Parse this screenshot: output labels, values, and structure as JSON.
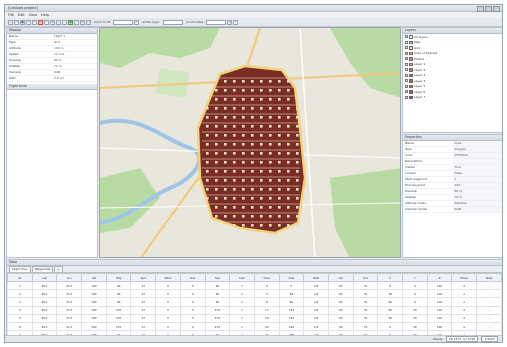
{
  "app": {
    "title": "[Untitled project]",
    "window_buttons": [
      "minimize",
      "maximize",
      "close"
    ]
  },
  "menu": [
    "File",
    "Edit",
    "View",
    "Help"
  ],
  "toolbar": {
    "zoom_label": "zoom to fit",
    "layer_label": "active layer",
    "coord_label": "coordinates"
  },
  "left_panel": {
    "title": "Mission",
    "properties": [
      {
        "key": "Name",
        "value": "Flight 1"
      },
      {
        "key": "Type",
        "value": "Grid"
      },
      {
        "key": "Altitude",
        "value": "100 m"
      },
      {
        "key": "Speed",
        "value": "12 m/s"
      },
      {
        "key": "Overlap",
        "value": "80 %"
      },
      {
        "key": "Sidelap",
        "value": "70 %"
      },
      {
        "key": "Camera",
        "value": "RGB"
      },
      {
        "key": "GSD",
        "value": "2.8 cm"
      }
    ],
    "footer": "Flight time"
  },
  "layers_panel": {
    "title": "Layers",
    "items": [
      {
        "label": "All layers",
        "color": "#ffffff"
      },
      {
        "label": "Map",
        "color": "#bfe3b0"
      },
      {
        "label": "Grid",
        "color": "#f2e6a8"
      },
      {
        "label": "Area of interest",
        "color": "#e7c9a0"
      },
      {
        "label": "Photos",
        "color": "#c98a7a"
      },
      {
        "label": "Layer 1",
        "color": "#d9a27b"
      },
      {
        "label": "Layer 2",
        "color": "#c87a60"
      },
      {
        "label": "Layer 3",
        "color": "#b56a55"
      },
      {
        "label": "Layer 4",
        "color": "#9c5b4b"
      },
      {
        "label": "Layer 5",
        "color": "#bb7e6a"
      },
      {
        "label": "Layer 6",
        "color": "#a45c4c"
      },
      {
        "label": "Layer 7",
        "color": "#8a4a3e"
      }
    ]
  },
  "props_panel": {
    "title": "Properties",
    "rows": [
      {
        "key": "Name",
        "value": "Area"
      },
      {
        "key": "Type",
        "value": "Polygon"
      },
      {
        "key": "Color",
        "value": "#FF0000"
      },
      {
        "key": "Description",
        "value": ""
      },
      {
        "key": "Visible",
        "value": "True"
      },
      {
        "key": "Locked",
        "value": "False"
      },
      {
        "key": "Start waypoint",
        "value": "1"
      },
      {
        "key": "End waypoint",
        "value": "120"
      },
      {
        "key": "Overlap",
        "value": "80 %"
      },
      {
        "key": "Sidelap",
        "value": "70 %"
      },
      {
        "key": "Altitude mode",
        "value": "Relative"
      },
      {
        "key": "Camera model",
        "value": "RGB"
      }
    ]
  },
  "bottom": {
    "title": "Data",
    "tabs": [
      "Flight Plan",
      "Waypoints",
      "+"
    ],
    "columns": [
      "ID",
      "Lat",
      "Lon",
      "Alt",
      "Hdg",
      "Spd",
      "Pitch",
      "Roll",
      "Yaw",
      "Cam",
      "Time",
      "Dist",
      "GSD",
      "Ovl",
      "Sdl",
      "X",
      "Y",
      "Z",
      "Mode",
      "Note"
    ],
    "rows": [
      [
        "1",
        "48.1",
        "11.5",
        "100",
        "90",
        "12",
        "0",
        "0",
        "90",
        "1",
        "0",
        "0",
        "2.8",
        "80",
        "70",
        "0",
        "0",
        "100",
        "A",
        "-"
      ],
      [
        "2",
        "48.1",
        "11.5",
        "100",
        "90",
        "12",
        "0",
        "0",
        "90",
        "1",
        "4",
        "48",
        "2.8",
        "80",
        "70",
        "48",
        "0",
        "100",
        "A",
        "-"
      ],
      [
        "3",
        "48.1",
        "11.5",
        "100",
        "90",
        "12",
        "0",
        "0",
        "90",
        "1",
        "8",
        "96",
        "2.8",
        "80",
        "70",
        "96",
        "0",
        "100",
        "A",
        "-"
      ],
      [
        "4",
        "48.1",
        "11.5",
        "100",
        "270",
        "12",
        "0",
        "0",
        "270",
        "1",
        "12",
        "144",
        "2.8",
        "80",
        "70",
        "96",
        "30",
        "100",
        "A",
        "-"
      ],
      [
        "5",
        "48.1",
        "11.5",
        "100",
        "270",
        "12",
        "0",
        "0",
        "270",
        "1",
        "16",
        "192",
        "2.8",
        "80",
        "70",
        "48",
        "30",
        "100",
        "A",
        "-"
      ],
      [
        "6",
        "48.1",
        "11.5",
        "100",
        "270",
        "12",
        "0",
        "0",
        "270",
        "1",
        "20",
        "240",
        "2.8",
        "80",
        "70",
        "0",
        "30",
        "100",
        "A",
        "-"
      ],
      [
        "7",
        "48.1",
        "11.5",
        "100",
        "90",
        "12",
        "0",
        "0",
        "90",
        "1",
        "24",
        "288",
        "2.8",
        "80",
        "70",
        "0",
        "60",
        "100",
        "A",
        "-"
      ]
    ]
  },
  "status": {
    "left": "Ready",
    "coords": "48.1372, 11.5756",
    "zoom": "1:5000"
  },
  "colors": {
    "grid_fill": "#7a2d25",
    "grid_outline": "#f1d37a",
    "map_bg": "#e9e6dc",
    "forest": "#b8dba4",
    "river": "#9ec5e8"
  }
}
